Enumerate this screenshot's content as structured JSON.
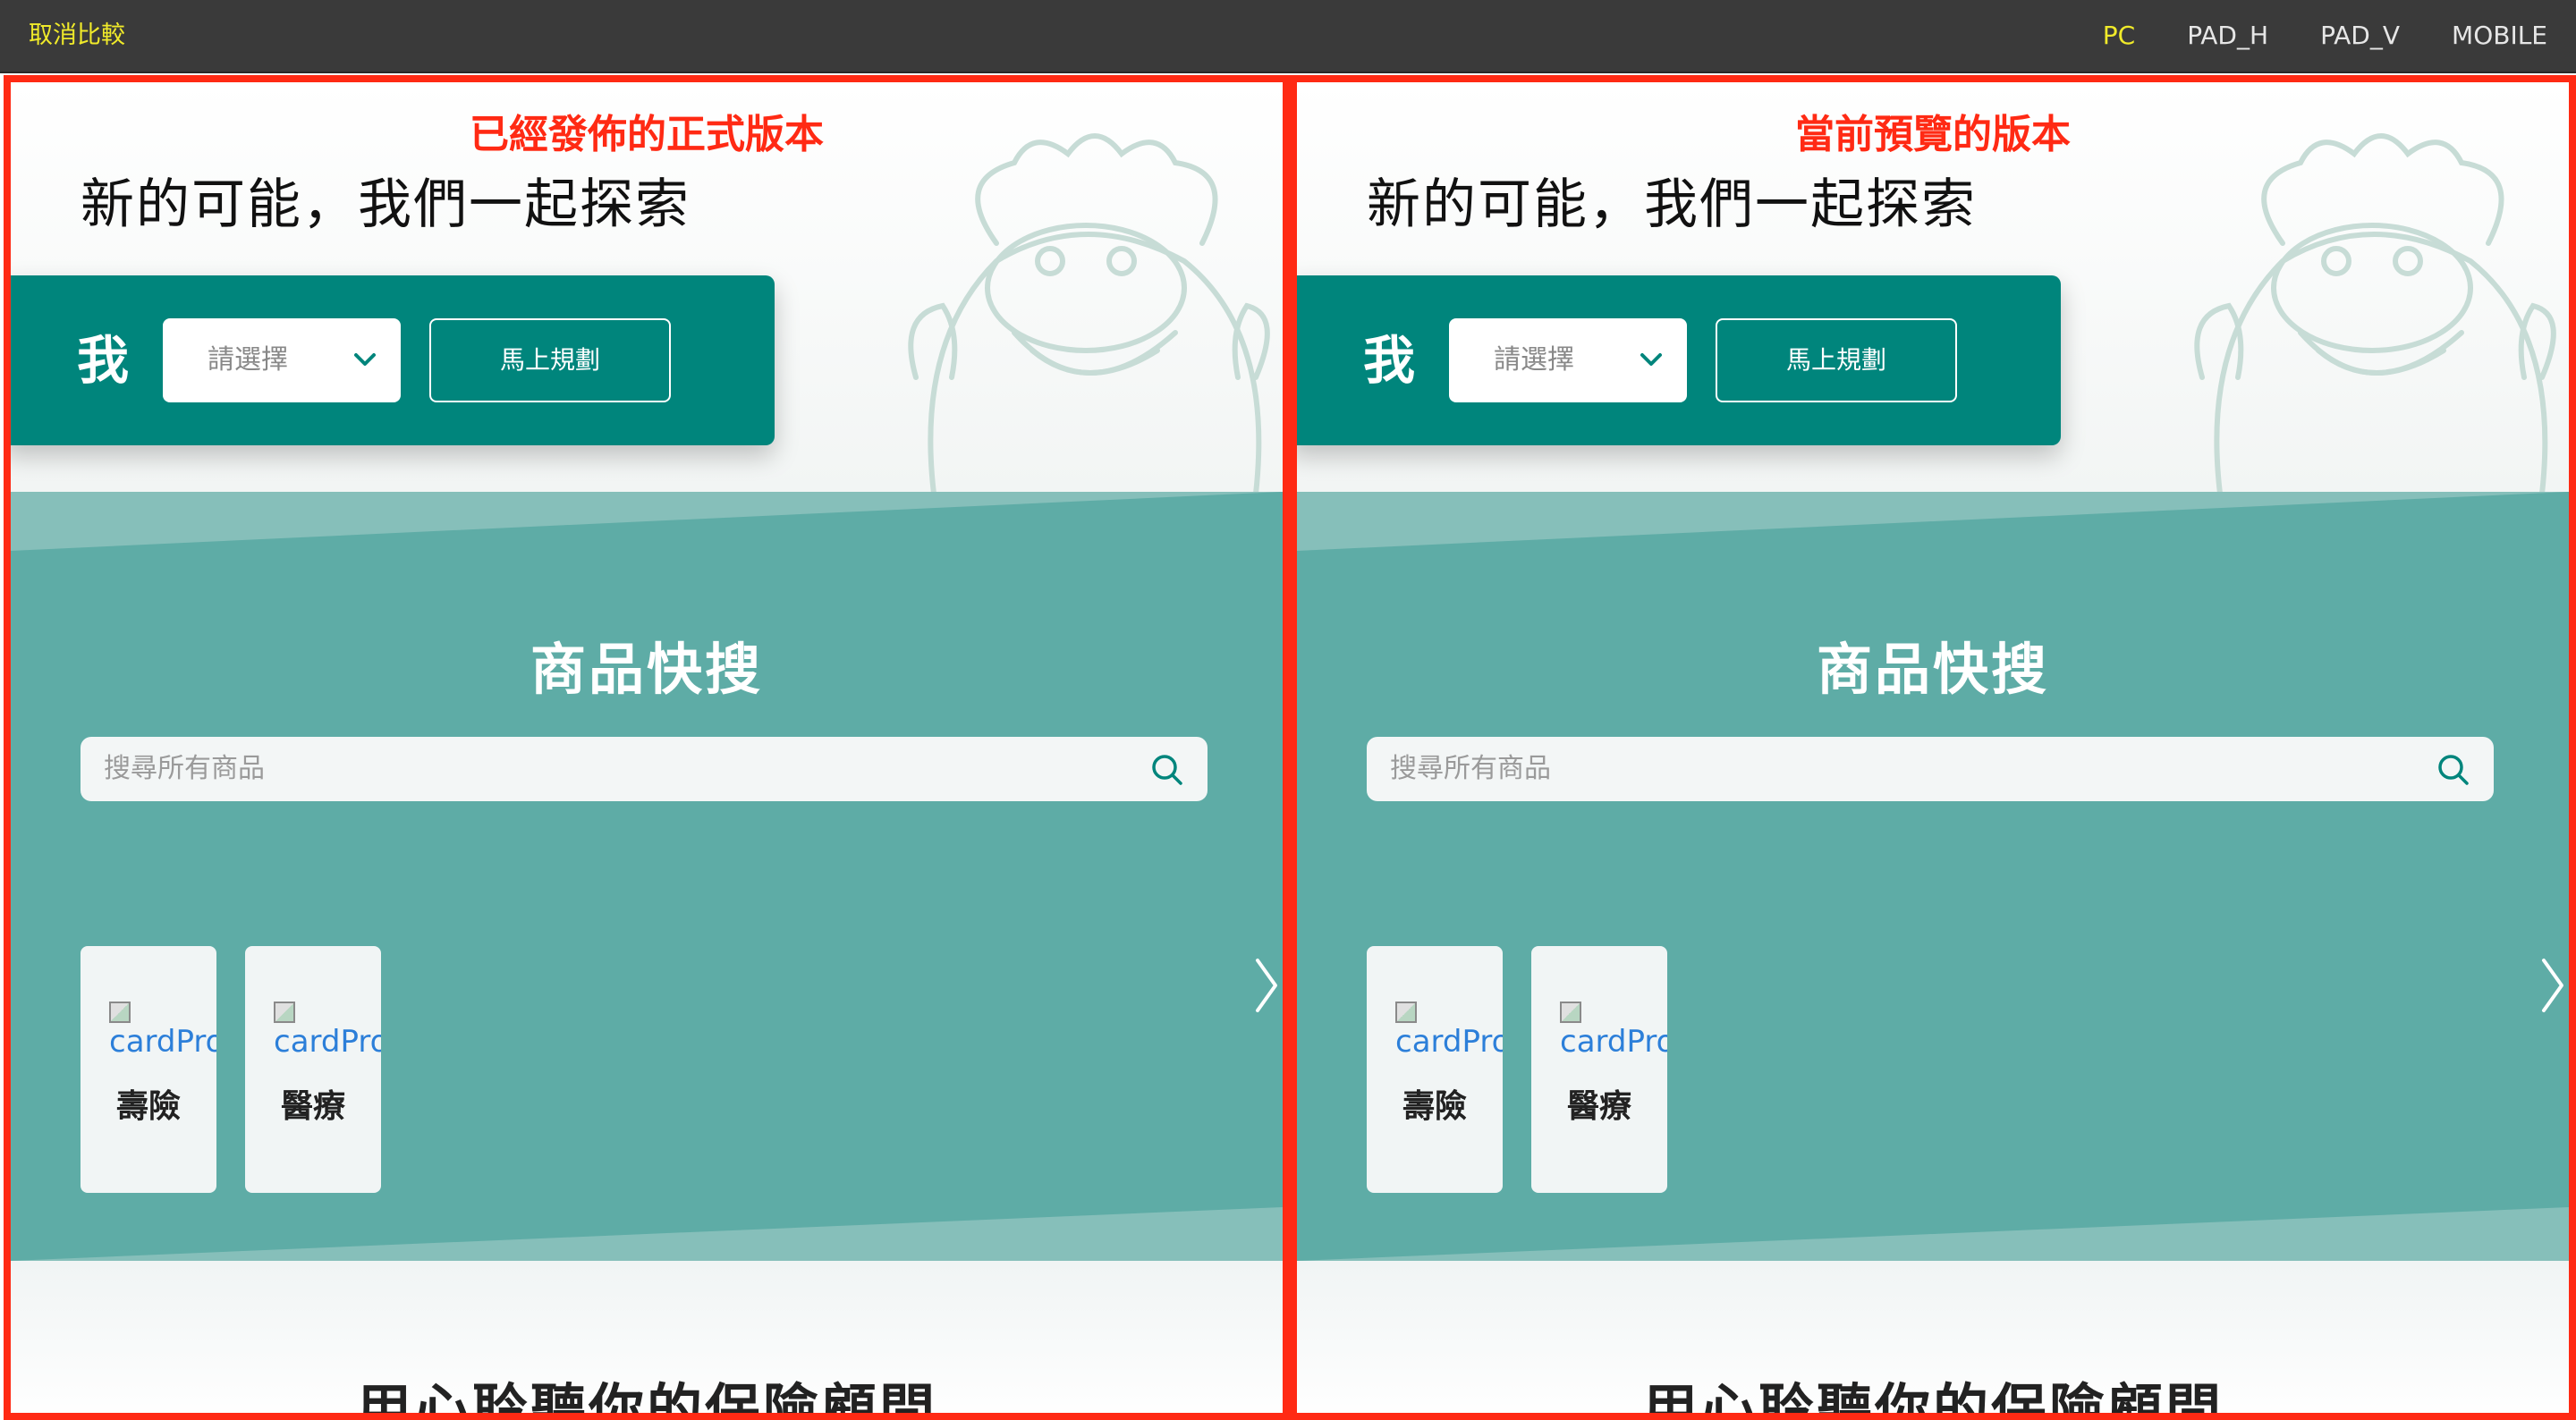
{
  "toolbar": {
    "cancel_compare": "取消比較",
    "devices": [
      "PC",
      "PAD_H",
      "PAD_V",
      "MOBILE"
    ],
    "active_device": "PC"
  },
  "panels": [
    {
      "version_label": "已經發佈的正式版本",
      "hero_title": "新的可能，我們一起探索",
      "planner_me": "我",
      "select_placeholder": "請選擇",
      "plan_button": "馬上規劃",
      "section_title": "商品快搜",
      "search_placeholder": "搜尋所有商品",
      "cards": [
        {
          "img_alt": "cardPro",
          "label": "壽險"
        },
        {
          "img_alt": "cardPro",
          "label": "醫療"
        }
      ],
      "advisor_title": "用心聆聽你的保險顧問"
    },
    {
      "version_label": "當前預覽的版本",
      "hero_title": "新的可能，我們一起探索",
      "planner_me": "我",
      "select_placeholder": "請選擇",
      "plan_button": "馬上規劃",
      "section_title": "商品快搜",
      "search_placeholder": "搜尋所有商品",
      "cards": [
        {
          "img_alt": "cardPro",
          "label": "壽險"
        },
        {
          "img_alt": "cardPro",
          "label": "醫療"
        }
      ],
      "advisor_title": "用心聆聽你的保險顧問"
    }
  ],
  "colors": {
    "compare_border": "#ff2a14",
    "brand_teal": "#00857c",
    "section_teal": "#5eaca6",
    "toolbar_bg": "#3a3a3a",
    "toolbar_active": "#f0ea2a"
  },
  "icons": [
    "chevron-down-icon",
    "search-icon",
    "chevron-right-icon",
    "mascot-illustration",
    "broken-image-icon"
  ]
}
